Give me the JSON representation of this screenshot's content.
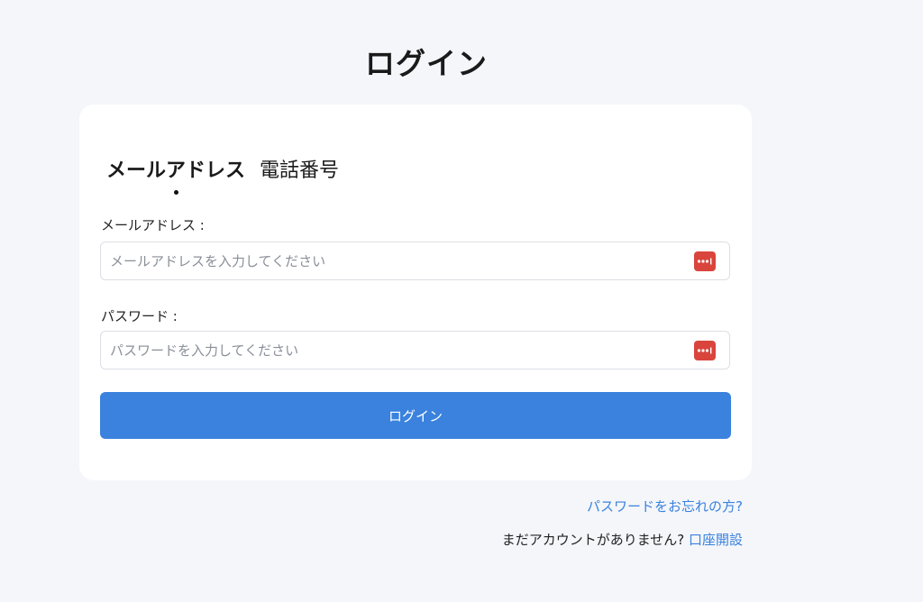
{
  "page": {
    "title": "ログイン"
  },
  "tabs": [
    {
      "label": "メールアドレス",
      "active": true
    },
    {
      "label": "電話番号",
      "active": false
    }
  ],
  "form": {
    "email": {
      "label": "メールアドレス :",
      "placeholder": "メールアドレスを入力してください",
      "value": ""
    },
    "password": {
      "label": "パスワード :",
      "placeholder": "パスワードを入力してください",
      "value": ""
    },
    "submit_label": "ログイン"
  },
  "links": {
    "forgot_password": "パスワードをお忘れの方?",
    "no_account_text": "まだアカウントがありません? ",
    "open_account": "口座開設"
  },
  "icons": {
    "password_manager": "password-manager-icon"
  },
  "colors": {
    "background": "#f4f6fa",
    "accent": "#3a82dd",
    "password_manager_icon": "#d9453c"
  }
}
